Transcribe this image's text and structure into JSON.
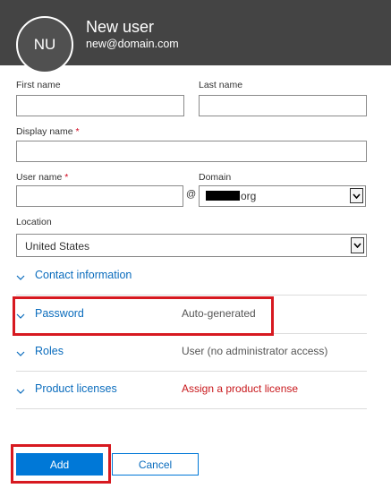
{
  "header": {
    "avatar_initials": "NU",
    "title": "New user",
    "email": "new@domain.com"
  },
  "form": {
    "first_name_label": "First name",
    "last_name_label": "Last name",
    "display_name_label": "Display name",
    "user_name_label": "User name",
    "required_marker": "*",
    "at_symbol": "@",
    "domain_label": "Domain",
    "domain_value": "org",
    "location_label": "Location",
    "location_value": "United States"
  },
  "sections": [
    {
      "title": "Contact information",
      "value": ""
    },
    {
      "title": "Password",
      "value": "Auto-generated"
    },
    {
      "title": "Roles",
      "value": "User (no administrator access)"
    },
    {
      "title": "Product licenses",
      "value": "Assign a product license"
    }
  ],
  "buttons": {
    "add": "Add",
    "cancel": "Cancel"
  },
  "colors": {
    "header_bg": "#444444",
    "accent_blue": "#0078d7",
    "link_blue": "#0a6cbd",
    "highlight_red": "#d71920",
    "warning_text": "#c8181c"
  },
  "icons": {
    "section_toggle": "chevron-down-icon",
    "select_caret": "chevron-down-icon"
  }
}
